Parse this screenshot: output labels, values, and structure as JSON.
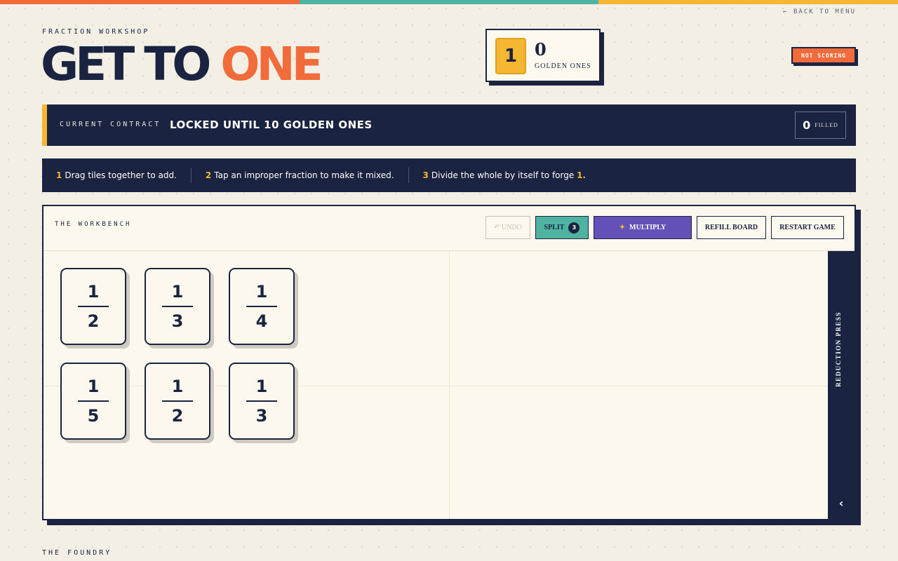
{
  "colors": {
    "top_bar": [
      "#f26b3a",
      "#4eb3a0",
      "#f5b732"
    ],
    "navy": "#1a2340",
    "orange": "#f26b3a",
    "gold": "#f5b732",
    "teal": "#4eb3a0",
    "purple": "#6550b8",
    "cream": "#fcf8ee"
  },
  "nav": {
    "back_label": "← BACK TO MENU"
  },
  "header": {
    "eyebrow": "FRACTION WORKSHOP",
    "title_part1": "GET TO",
    "title_part2": "ONE"
  },
  "score": {
    "tile_value": "1",
    "count": "0",
    "label": "GOLDEN ONES"
  },
  "status_badge": "NOT SCORING",
  "contract": {
    "label": "CURRENT CONTRACT",
    "status": "LOCKED UNTIL 10 GOLDEN ONES",
    "filled_count": "0",
    "filled_label": "FILLED"
  },
  "steps": [
    {
      "num": "1",
      "text": "Drag tiles together to add."
    },
    {
      "num": "2",
      "text": "Tap an improper fraction to make it mixed."
    },
    {
      "num": "3",
      "text": "Divide the whole by itself to forge",
      "highlight": "1."
    }
  ],
  "workbench": {
    "title": "THE WORKBENCH",
    "buttons": {
      "undo": "↶ UNDO",
      "split": "SPLIT",
      "split_count": "3",
      "multiply_icon": "✦",
      "multiply": "MULTIPLY",
      "refill": "REFILL BOARD",
      "restart": "RESTART GAME"
    },
    "tiles": [
      {
        "numerator": "1",
        "denominator": "2"
      },
      {
        "numerator": "1",
        "denominator": "3"
      },
      {
        "numerator": "1",
        "denominator": "4"
      },
      {
        "numerator": "1",
        "denominator": "5"
      },
      {
        "numerator": "1",
        "denominator": "2"
      },
      {
        "numerator": "1",
        "denominator": "3"
      }
    ],
    "press_label": "REDUCTION PRESS",
    "press_toggle": "‹"
  },
  "foundry_label": "THE FOUNDRY"
}
